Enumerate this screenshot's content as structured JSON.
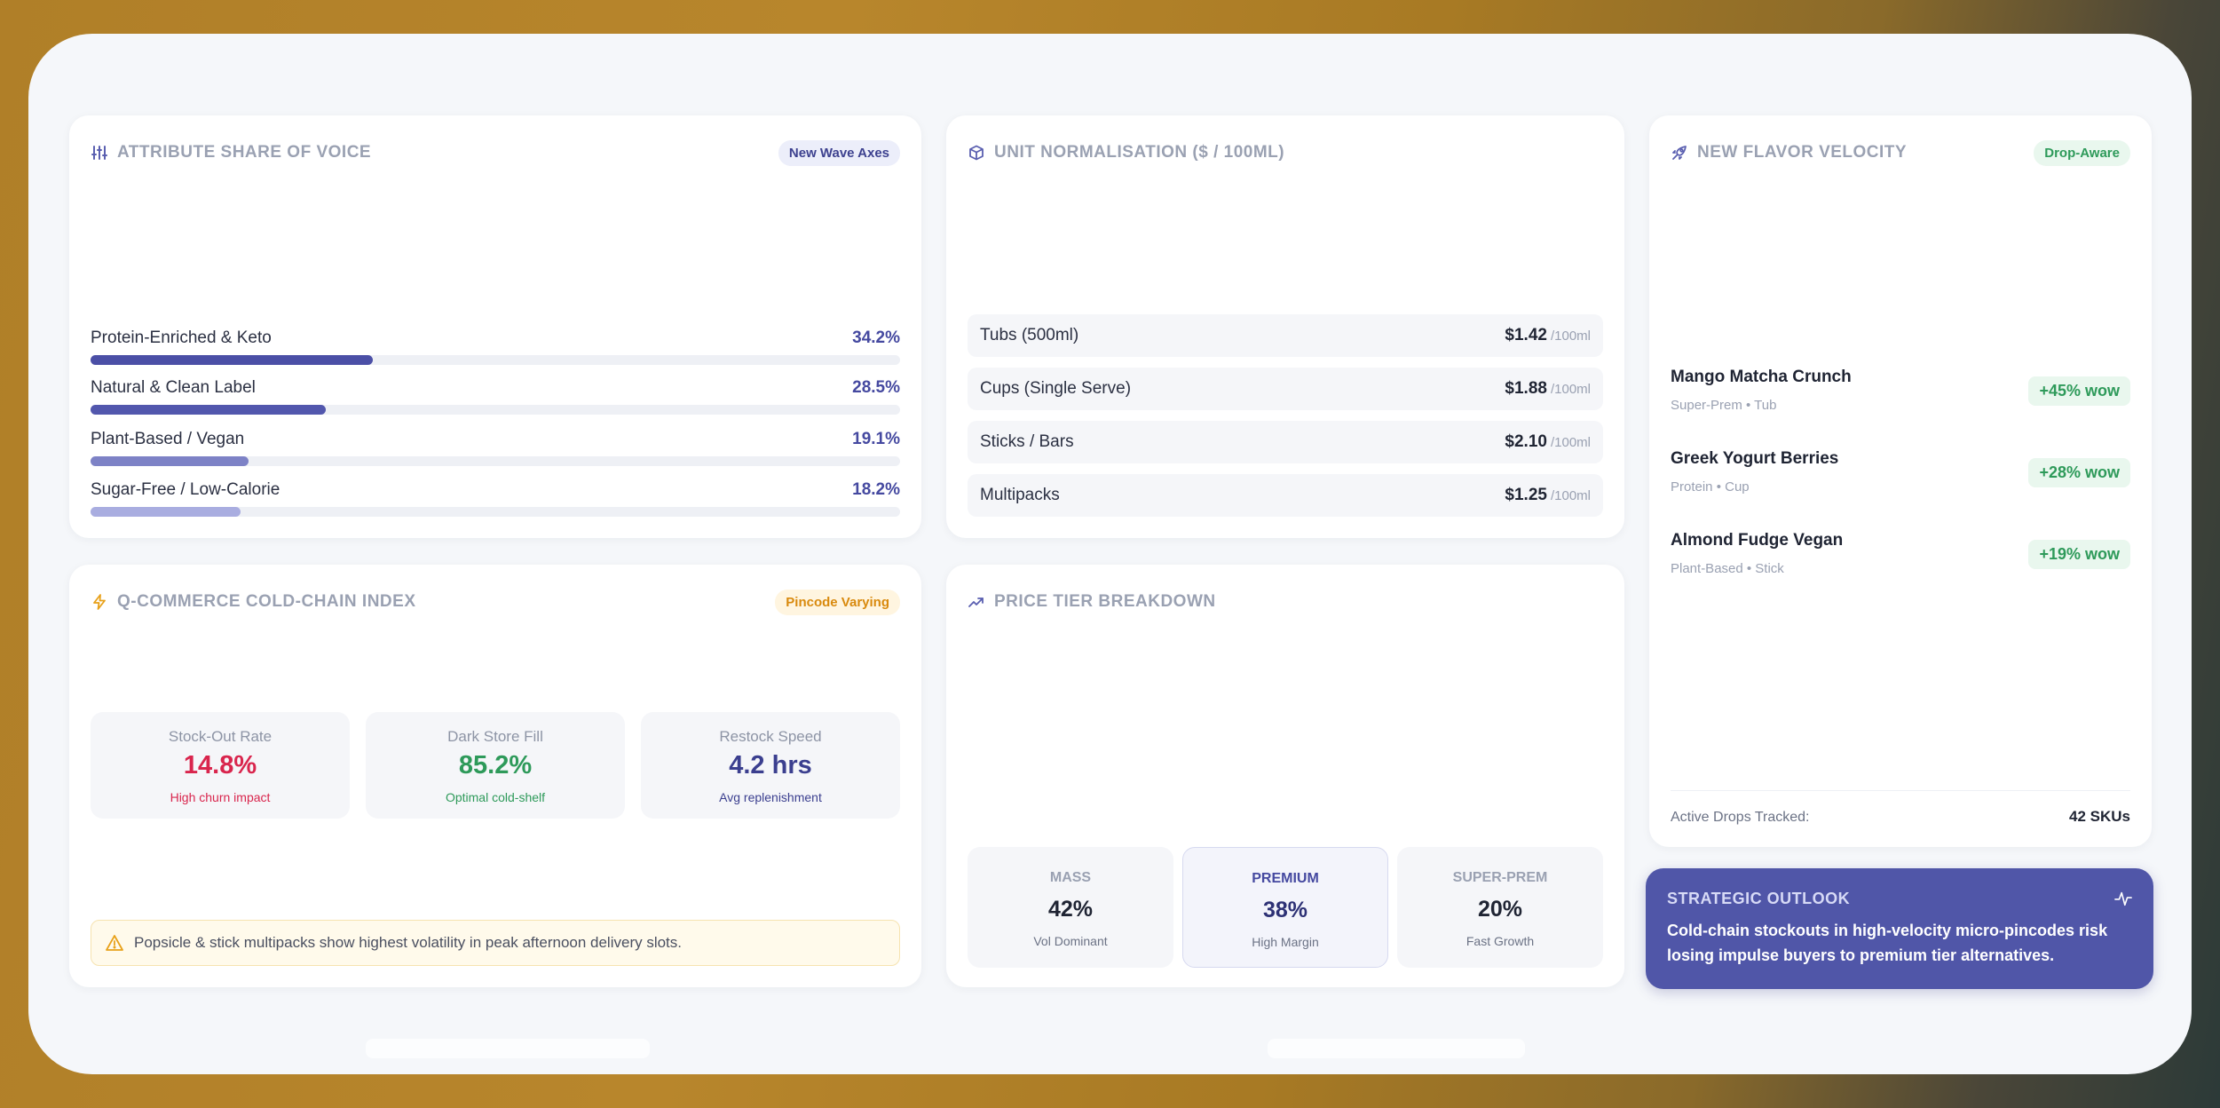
{
  "attribute": {
    "title": "Attribute Share of Voice",
    "badge": "New Wave Axes",
    "items": [
      {
        "label": "Protein-Enriched & Keto",
        "value": "34.2%",
        "pct": 34.2,
        "color": "#4b4fa6"
      },
      {
        "label": "Natural & Clean Label",
        "value": "28.5%",
        "pct": 28.5,
        "color": "#5257ad"
      },
      {
        "label": "Plant-Based / Vegan",
        "value": "19.1%",
        "pct": 19.1,
        "color": "#7d82c6"
      },
      {
        "label": "Sugar-Free / Low-Calorie",
        "value": "18.2%",
        "pct": 18.2,
        "color": "#a9ade0"
      }
    ]
  },
  "unit": {
    "title": "Unit Normalisation ($ / 100ml)",
    "suffix": "/100ml",
    "items": [
      {
        "label": "Tubs (500ml)",
        "price": "$1.42"
      },
      {
        "label": "Cups (Single Serve)",
        "price": "$1.88"
      },
      {
        "label": "Sticks / Bars",
        "price": "$2.10"
      },
      {
        "label": "Multipacks",
        "price": "$1.25"
      }
    ]
  },
  "velocity": {
    "title": "New Flavor Velocity",
    "badge": "Drop-Aware",
    "items": [
      {
        "name": "Mango Matcha Crunch",
        "sub": "Super-Prem • Tub",
        "badge": "+45% wow"
      },
      {
        "name": "Greek Yogurt Berries",
        "sub": "Protein • Cup",
        "badge": "+28% wow"
      },
      {
        "name": "Almond Fudge Vegan",
        "sub": "Plant-Based • Stick",
        "badge": "+19% wow"
      }
    ],
    "footer_label": "Active Drops Tracked:",
    "footer_value": "42 SKUs"
  },
  "coldchain": {
    "title": "Q-Commerce Cold-Chain Index",
    "badge": "Pincode Varying",
    "stats": [
      {
        "label": "Stock-Out Rate",
        "value": "14.8%",
        "sub": "High churn impact",
        "color": "#d9254d"
      },
      {
        "label": "Dark Store Fill",
        "value": "85.2%",
        "sub": "Optimal cold-shelf",
        "color": "#2e9a5a"
      },
      {
        "label": "Restock Speed",
        "value": "4.2 hrs",
        "sub": "Avg replenishment",
        "color": "#3b3f8f"
      }
    ],
    "notice": "Popsicle & stick multipacks show highest volatility in peak afternoon delivery slots."
  },
  "tiers": {
    "title": "Price Tier Breakdown",
    "items": [
      {
        "label": "MASS",
        "value": "42%",
        "sub": "Vol Dominant"
      },
      {
        "label": "PREMIUM",
        "value": "38%",
        "sub": "High Margin"
      },
      {
        "label": "SUPER-PREM",
        "value": "20%",
        "sub": "Fast Growth"
      }
    ]
  },
  "outlook": {
    "title": "STRATEGIC OUTLOOK",
    "text": "Cold-chain stockouts in high-velocity micro-pincodes risk losing impulse buyers to premium tier alternatives."
  }
}
